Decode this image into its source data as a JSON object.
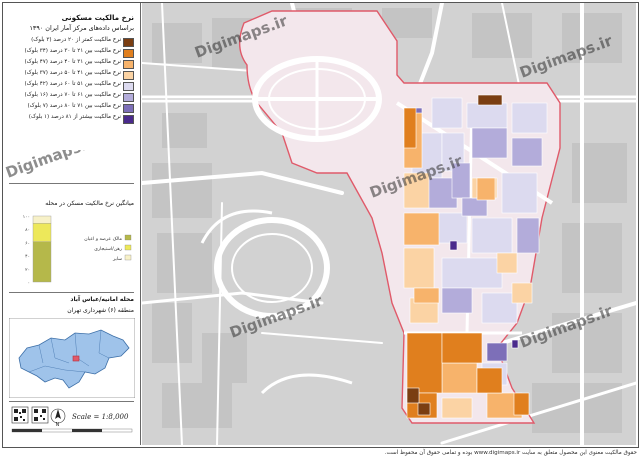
{
  "legend": {
    "title": "نرخ مالکیت مسکونی",
    "subtitle": "براساس داده‌های مرکز آمار ایران ۱۳۹۰",
    "classes": [
      {
        "label": "نرخ مالکیت کمتر از ۲۰ درصد (۳ بلوک)",
        "color": "#7a3e12"
      },
      {
        "label": "نرخ مالکیت بین ۲۱ تا ۳۰ درصد (۳۴ بلوک)",
        "color": "#e07f1e"
      },
      {
        "label": "نرخ مالکیت بین ۳۱ تا ۴۰ درصد (۴۷ بلوک)",
        "color": "#f7b36b"
      },
      {
        "label": "نرخ مالکیت بین ۴۱ تا ۵۰ درصد (۳۷ بلوک)",
        "color": "#fbd3a4"
      },
      {
        "label": "نرخ مالکیت بین ۵۱ تا ۶۰ درصد (۴۲ بلوک)",
        "color": "#dcdaef"
      },
      {
        "label": "نرخ مالکیت بین ۶۱ تا ۷۰ درصد (۱۶ بلوک)",
        "color": "#b3acda"
      },
      {
        "label": "نرخ مالکیت بین ۷۱ تا ۸۰ درصد (۷ بلوک)",
        "color": "#7d6fb8"
      },
      {
        "label": "نرخ مالکیت بیشتر از ۸۱ درصد (۱ بلوک)",
        "color": "#4a2a8c"
      }
    ]
  },
  "chart": {
    "title": "میانگین نرخ مالکیت مسکن در محله",
    "ticks": [
      "۱۰۰",
      "۸۰",
      "۶۰",
      "۴۰",
      "۲۰",
      "۰"
    ],
    "segments": [
      {
        "label": "مالک عرصه و اعیان",
        "color": "#b5b84a",
        "value": 61
      },
      {
        "label": "رهن/استیجاری",
        "color": "#ede85a",
        "value": 28
      },
      {
        "label": "سایر",
        "color": "#f7f1c8",
        "value": 11
      }
    ]
  },
  "location": {
    "title": "محله امانیه/عباس آباد",
    "subtitle": "منطقه (۶) شهرداری تهران"
  },
  "scale": "Scale = 1:8,000",
  "footer": "حقوق مالکیت معنوی این محصول متعلق به سایت www.digimaps.ir بوده و تمامی حقوق آن محفوظ است.",
  "watermark": "Digimaps.ir",
  "colors": {
    "roads": "#ffffff",
    "background": "#d2d2d2",
    "boundary": "#e05a6a",
    "pink_area": "#f3e7ec"
  }
}
